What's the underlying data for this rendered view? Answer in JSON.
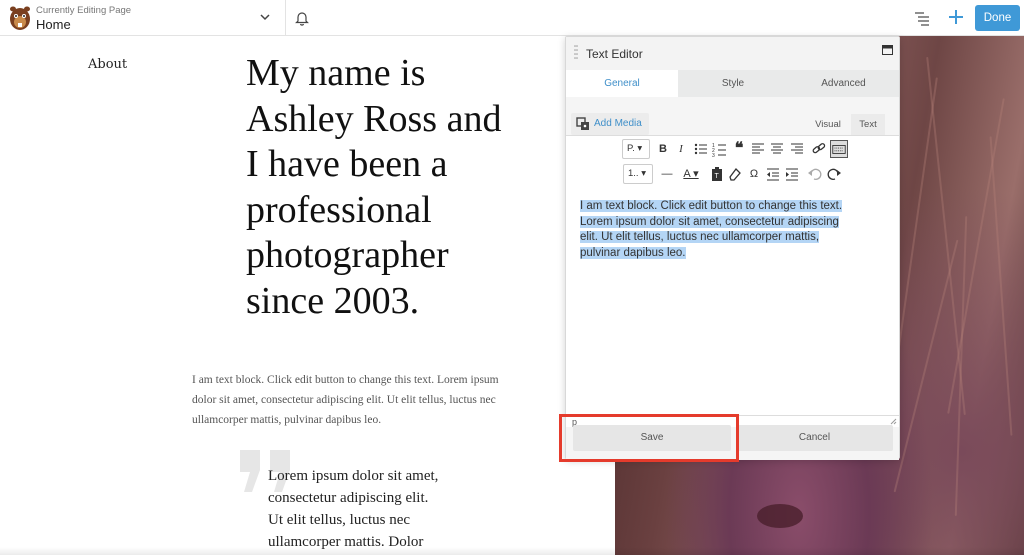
{
  "topbar": {
    "page_label": "Currently Editing Page",
    "page_name": "Home",
    "done_label": "Done"
  },
  "page": {
    "nav_about": "About",
    "hero_lines": [
      "My name is",
      "Ashley Ross and",
      "I have been a",
      "professional",
      "photographer",
      "since 2003."
    ],
    "body_lines": [
      "I am text block. Click edit button to change this text. Lorem ipsum",
      "dolor sit amet, consectetur adipiscing elit. Ut elit tellus, luctus nec",
      "ullamcorper mattis, pulvinar dapibus leo."
    ],
    "quote_lines": [
      "Lorem ipsum dolor sit amet,",
      "consectetur adipiscing elit.",
      "Ut elit tellus, luctus nec",
      "ullamcorper mattis. Dolor"
    ]
  },
  "editor": {
    "title": "Text Editor",
    "tabs": [
      {
        "label": "General"
      },
      {
        "label": "Style"
      },
      {
        "label": "Advanced"
      }
    ],
    "add_media": "Add Media",
    "mode_visual": "Visual",
    "mode_text": "Text",
    "format_select": "P.",
    "list_select": "1..",
    "content_lines": [
      "I am text block. Click edit button to change this text.",
      "Lorem ipsum dolor sit amet, consectetur adipiscing",
      "elit. Ut elit tellus, luctus nec ullamcorper mattis,",
      "pulvinar dapibus leo."
    ],
    "status_path": "p",
    "save_label": "Save",
    "cancel_label": "Cancel"
  },
  "colors": {
    "accent": "#3f99d7",
    "highlight": "#e53b2c",
    "selection": "#b4d5f5"
  }
}
